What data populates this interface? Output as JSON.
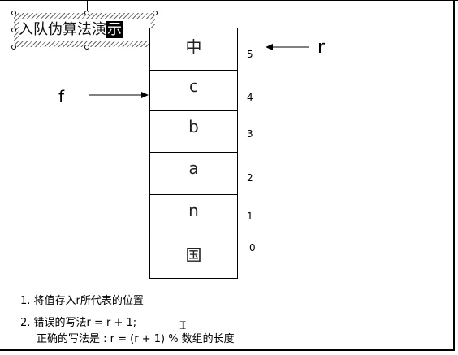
{
  "title": {
    "text_main": "入队伪算法演",
    "text_selected": "示"
  },
  "queue": {
    "cells": [
      "中",
      "c",
      "b",
      "a",
      "n",
      "国"
    ],
    "indices": [
      "5",
      "4",
      "3",
      "2",
      "1",
      "0"
    ]
  },
  "pointers": {
    "rear": "r",
    "front": "f"
  },
  "notes": {
    "item1": "1.  将值存入r所代表的位置",
    "item2_line1": "2.  错误的写法r = r + 1;",
    "item2_line2": "正确的写法是 : r = (r + 1) % 数组的长度"
  },
  "colors": {
    "stroke": "#000000",
    "background": "#ffffff",
    "selection": "#000000"
  },
  "icons": [
    "resize-handle-icon",
    "arrow-icon",
    "text-cursor-icon"
  ]
}
